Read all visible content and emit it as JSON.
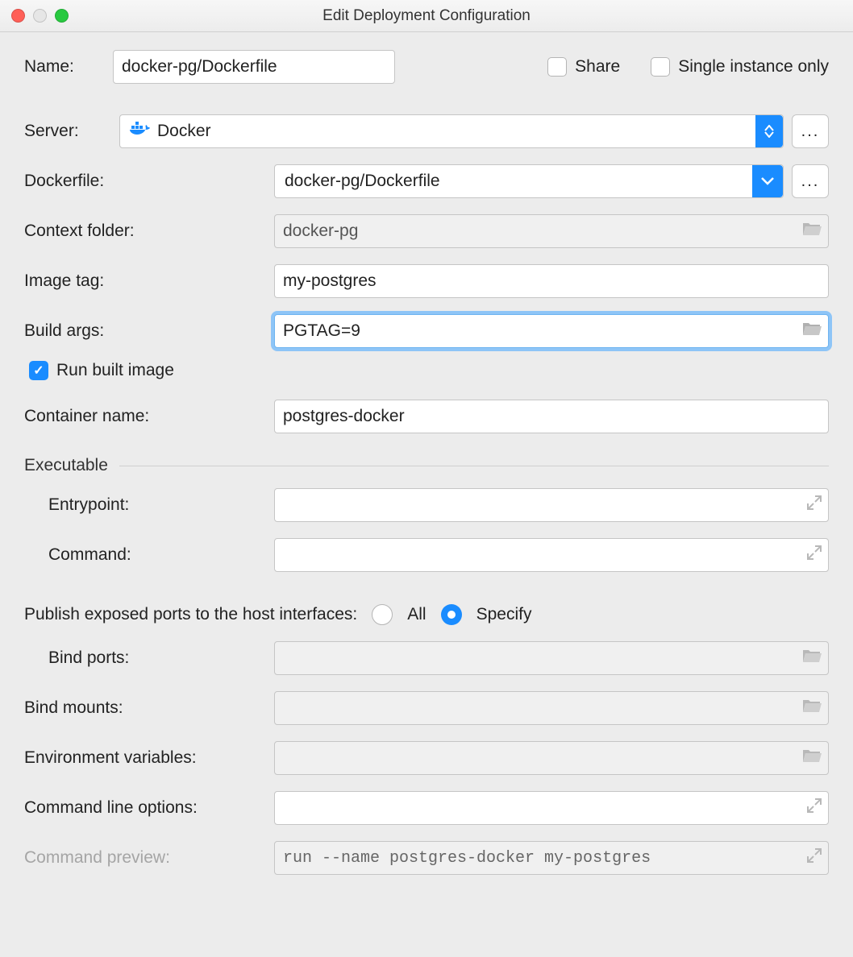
{
  "window": {
    "title": "Edit Deployment Configuration"
  },
  "fields": {
    "name_label": "Name:",
    "name_value": "docker-pg/Dockerfile",
    "share_label": "Share",
    "share_checked": false,
    "single_instance_label": "Single instance only",
    "single_instance_checked": false,
    "server_label": "Server:",
    "server_value": "Docker",
    "dockerfile_label": "Dockerfile:",
    "dockerfile_value": "docker-pg/Dockerfile",
    "context_label": "Context folder:",
    "context_value": "docker-pg",
    "image_tag_label": "Image tag:",
    "image_tag_value": "my-postgres",
    "build_args_label": "Build args:",
    "build_args_value": "PGTAG=9",
    "run_built_label": "Run built image",
    "run_built_checked": true,
    "container_name_label": "Container name:",
    "container_name_value": "postgres-docker",
    "executable_heading": "Executable",
    "entrypoint_label": "Entrypoint:",
    "entrypoint_value": "",
    "command_label": "Command:",
    "command_value": "",
    "ports_publish_label": "Publish exposed ports to the host interfaces:",
    "ports_all_label": "All",
    "ports_specify_label": "Specify",
    "ports_selected": "specify",
    "bind_ports_label": "Bind ports:",
    "bind_ports_value": "",
    "bind_mounts_label": "Bind mounts:",
    "bind_mounts_value": "",
    "env_vars_label": "Environment variables:",
    "env_vars_value": "",
    "cli_options_label": "Command line options:",
    "cli_options_value": "",
    "preview_label": "Command preview:",
    "preview_value": "run --name postgres-docker my-postgres"
  }
}
